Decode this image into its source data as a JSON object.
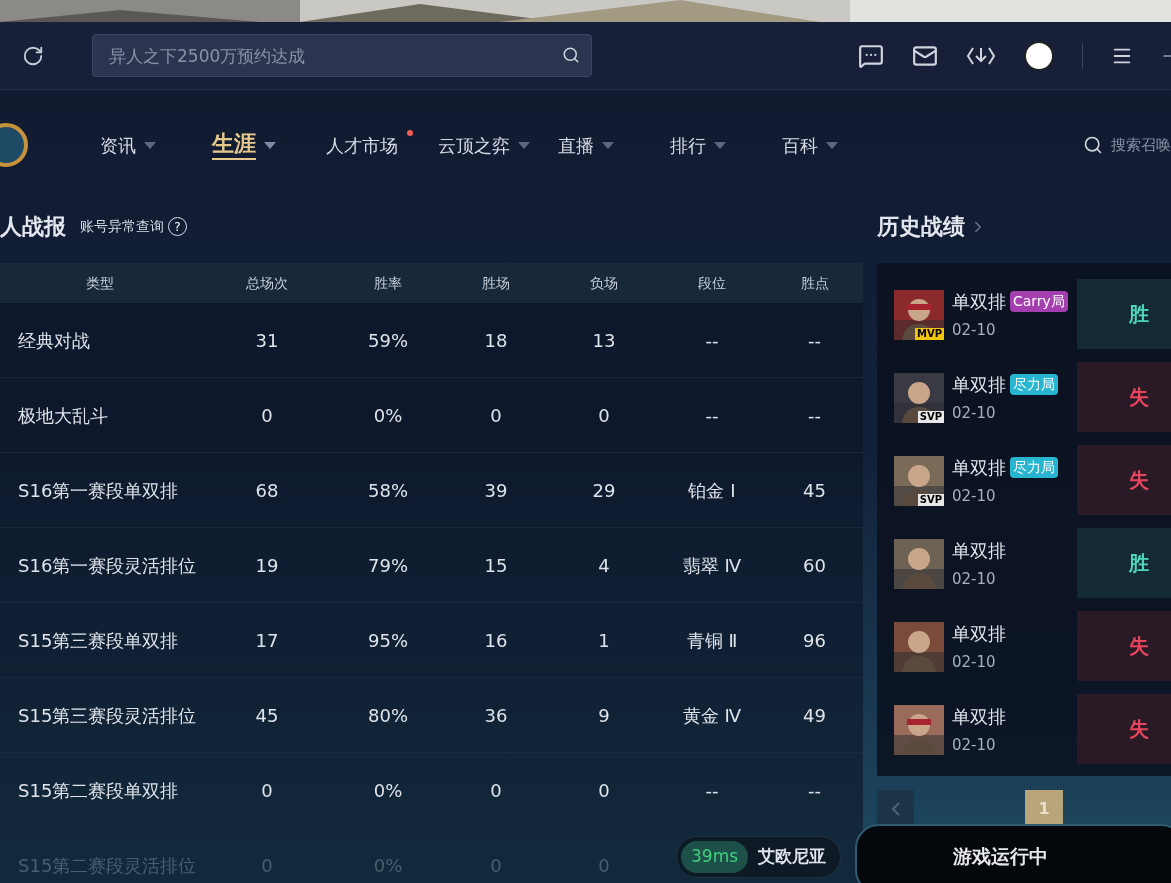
{
  "search": {
    "placeholder": "异人之下2500万预约达成"
  },
  "nav": [
    {
      "label": "资讯",
      "selected": false,
      "dropdown": true,
      "dot": false
    },
    {
      "label": "生涯",
      "selected": true,
      "dropdown": true,
      "dot": false
    },
    {
      "label": "人才市场",
      "selected": false,
      "dropdown": false,
      "dot": true
    },
    {
      "label": "云顶之弈",
      "selected": false,
      "dropdown": true,
      "dot": false
    },
    {
      "label": "直播",
      "selected": false,
      "dropdown": true,
      "dot": false
    },
    {
      "label": "排行",
      "selected": false,
      "dropdown": true,
      "dot": false
    },
    {
      "label": "百科",
      "selected": false,
      "dropdown": true,
      "dot": false
    }
  ],
  "nav_search": {
    "placeholder": "搜索召唤"
  },
  "stats": {
    "title": "人战报",
    "link": "账号异常查询",
    "help": "?",
    "columns": [
      "类型",
      "总场次",
      "胜率",
      "胜场",
      "负场",
      "段位",
      "胜点"
    ],
    "rows": [
      {
        "faded": false,
        "cells": [
          "经典对战",
          "31",
          "59%",
          "18",
          "13",
          "--",
          "--"
        ]
      },
      {
        "faded": false,
        "cells": [
          "极地大乱斗",
          "0",
          "0%",
          "0",
          "0",
          "--",
          "--"
        ]
      },
      {
        "faded": false,
        "cells": [
          "S16第一赛段单双排",
          "68",
          "58%",
          "39",
          "29",
          "铂金 Ⅰ",
          "45"
        ]
      },
      {
        "faded": false,
        "cells": [
          "S16第一赛段灵活排位",
          "19",
          "79%",
          "15",
          "4",
          "翡翠 Ⅳ",
          "60"
        ]
      },
      {
        "faded": false,
        "cells": [
          "S15第三赛段单双排",
          "17",
          "95%",
          "16",
          "1",
          "青铜 Ⅱ",
          "96"
        ]
      },
      {
        "faded": false,
        "cells": [
          "S15第三赛段灵活排位",
          "45",
          "80%",
          "36",
          "9",
          "黄金 Ⅳ",
          "49"
        ]
      },
      {
        "faded": false,
        "cells": [
          "S15第二赛段单双排",
          "0",
          "0%",
          "0",
          "0",
          "--",
          "--"
        ]
      },
      {
        "faded": true,
        "cells": [
          "S15第二赛段灵活排位",
          "0",
          "0%",
          "0",
          "0"
        ]
      }
    ]
  },
  "history": {
    "title": "历史战绩",
    "matches": [
      {
        "mode": "单双排",
        "date": "02-10",
        "badge": "MVP",
        "tag": "Carry局",
        "color": "#a43fb0",
        "result": "胜",
        "kind": "win"
      },
      {
        "mode": "单双排",
        "date": "02-10",
        "badge": "SVP",
        "tag": "尽力局",
        "color": "#27b5cf",
        "result": "失",
        "kind": "loss"
      },
      {
        "mode": "单双排",
        "date": "02-10",
        "badge": "SVP",
        "tag": "尽力局",
        "color": "#27b5cf",
        "result": "失",
        "kind": "loss"
      },
      {
        "mode": "单双排",
        "date": "02-10",
        "result": "胜",
        "kind": "win"
      },
      {
        "mode": "单双排",
        "date": "02-10",
        "result": "失",
        "kind": "loss"
      },
      {
        "mode": "单双排",
        "date": "02-10",
        "result": "失",
        "kind": "loss"
      }
    ],
    "pages": [
      {
        "label": "1",
        "selected": true
      }
    ]
  },
  "server": {
    "ping": "39ms",
    "name": "艾欧尼亚"
  },
  "game_button": "游戏运行中"
}
